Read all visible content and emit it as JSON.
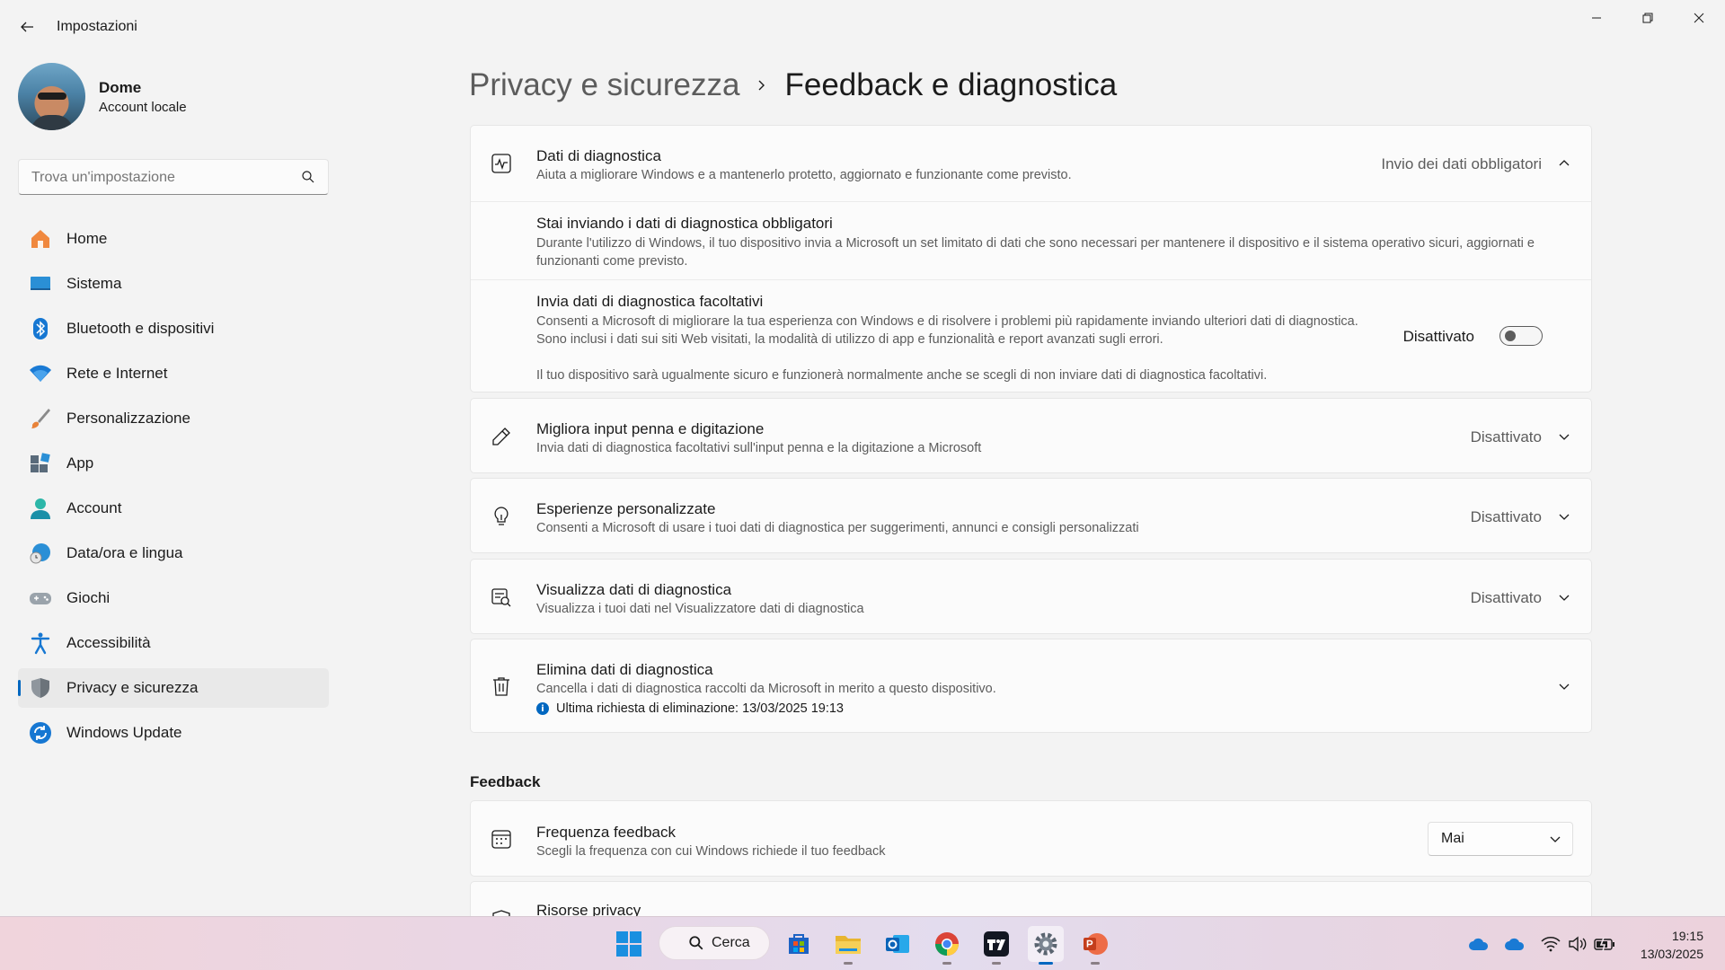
{
  "window": {
    "title": "Impostazioni"
  },
  "profile": {
    "name": "Dome",
    "account_type": "Account locale"
  },
  "search": {
    "placeholder": "Trova un'impostazione"
  },
  "sidebar": {
    "items": [
      {
        "label": "Home",
        "icon": "home-icon"
      },
      {
        "label": "Sistema",
        "icon": "system-icon"
      },
      {
        "label": "Bluetooth e dispositivi",
        "icon": "bluetooth-icon"
      },
      {
        "label": "Rete e Internet",
        "icon": "wifi-icon"
      },
      {
        "label": "Personalizzazione",
        "icon": "brush-icon"
      },
      {
        "label": "App",
        "icon": "apps-icon"
      },
      {
        "label": "Account",
        "icon": "account-icon"
      },
      {
        "label": "Data/ora e lingua",
        "icon": "globe-clock-icon"
      },
      {
        "label": "Giochi",
        "icon": "gamepad-icon"
      },
      {
        "label": "Accessibilità",
        "icon": "accessibility-icon"
      },
      {
        "label": "Privacy e sicurezza",
        "icon": "shield-icon",
        "active": true
      },
      {
        "label": "Windows Update",
        "icon": "update-icon"
      }
    ]
  },
  "breadcrumb": {
    "parent": "Privacy e sicurezza",
    "current": "Feedback e diagnostica"
  },
  "diagnostics": {
    "title": "Dati di diagnostica",
    "description": "Aiuta a migliorare Windows e a mantenerlo protetto, aggiornato e funzionante come previsto.",
    "value": "Invio dei dati obbligatori",
    "required": {
      "title": "Stai inviando i dati di diagnostica obbligatori",
      "description": "Durante l'utilizzo di Windows, il tuo dispositivo invia a Microsoft un set limitato di dati che sono necessari per mantenere il dispositivo e il sistema operativo sicuri, aggiornati e funzionanti come previsto."
    },
    "optional": {
      "title": "Invia dati di diagnostica facoltativi",
      "description": "Consenti a Microsoft di migliorare la tua esperienza con Windows e di risolvere i problemi più rapidamente inviando ulteriori dati di diagnostica. Sono inclusi i dati sui siti Web visitati, la modalità di utilizzo di app e funzionalità e report avanzati sugli errori.",
      "note": "Il tuo dispositivo sarà ugualmente sicuro e funzionerà normalmente anche se scegli di non inviare dati di diagnostica facoltativi.",
      "state_label": "Disattivato",
      "enabled": false
    }
  },
  "settings": [
    {
      "title": "Migliora input penna e digitazione",
      "description": "Invia dati di diagnostica facoltativi sull'input penna e la digitazione a Microsoft",
      "value": "Disattivato",
      "icon": "pen-icon"
    },
    {
      "title": "Esperienze personalizzate",
      "description": "Consenti a Microsoft di usare i tuoi dati di diagnostica per suggerimenti, annunci e consigli personalizzati",
      "value": "Disattivato",
      "icon": "lightbulb-icon"
    },
    {
      "title": "Visualizza dati di diagnostica",
      "description": "Visualizza i tuoi dati nel Visualizzatore dati di diagnostica",
      "value": "Disattivato",
      "icon": "data-viewer-icon"
    }
  ],
  "delete": {
    "title": "Elimina dati di diagnostica",
    "description": "Cancella i dati di diagnostica raccolti da Microsoft in merito a questo dispositivo.",
    "info": "Ultima richiesta di eliminazione: 13/03/2025 19:13"
  },
  "feedback": {
    "section_title": "Feedback",
    "frequency": {
      "title": "Frequenza feedback",
      "description": "Scegli la frequenza con cui Windows richiede il tuo feedback",
      "value": "Mai"
    },
    "privacy_resources": {
      "title": "Risorse privacy"
    }
  },
  "taskbar": {
    "search_label": "Cerca",
    "time": "19:15",
    "date": "13/03/2025"
  }
}
